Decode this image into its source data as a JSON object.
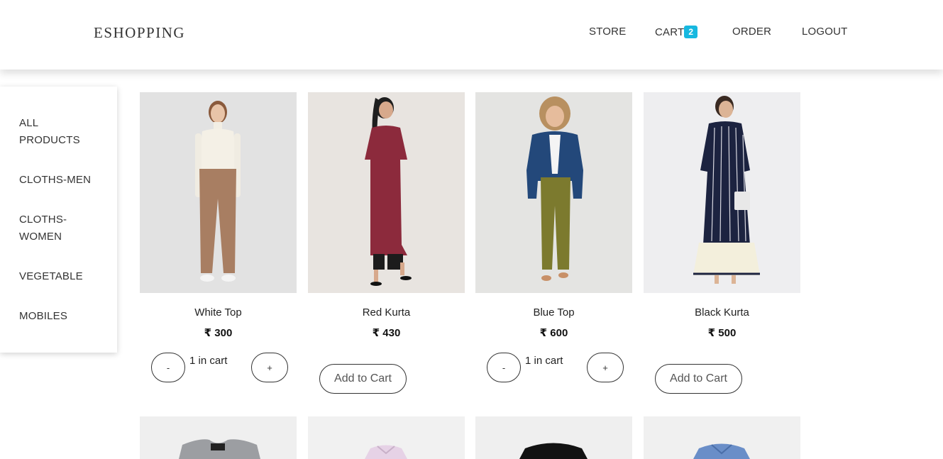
{
  "brand": "ESHOPPING",
  "nav": {
    "store": "STORE",
    "cart": "CART",
    "cart_count": "2",
    "order": "ORDER",
    "logout": "LOGOUT"
  },
  "sidebar": {
    "items": [
      {
        "label_line1": "ALL",
        "label_line2": "PRODUCTS"
      },
      {
        "label_line1": "CLOTHS-MEN",
        "label_line2": ""
      },
      {
        "label_line1": "CLOTHS-",
        "label_line2": "WOMEN"
      },
      {
        "label_line1": "VEGETABLE",
        "label_line2": ""
      },
      {
        "label_line1": "MOBILES",
        "label_line2": ""
      }
    ]
  },
  "products": [
    {
      "name": "White Top",
      "price": "₹ 300",
      "in_cart": "1 in cart",
      "minus": "-",
      "plus": "+"
    },
    {
      "name": "Red Kurta",
      "price": "₹ 430",
      "add_label": "Add to Cart"
    },
    {
      "name": "Blue Top",
      "price": "₹ 600",
      "in_cart": "1 in cart",
      "minus": "-",
      "plus": "+"
    },
    {
      "name": "Black Kurta",
      "price": "₹ 500",
      "add_label": "Add to Cart"
    }
  ],
  "colors": {
    "badge": "#16b8e0",
    "text": "#333333"
  }
}
